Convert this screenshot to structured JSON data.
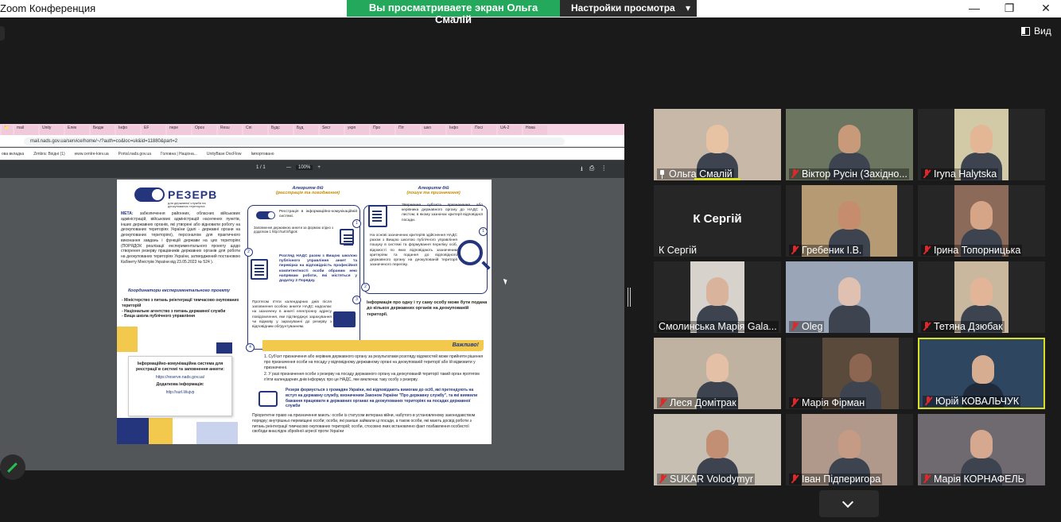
{
  "window": {
    "app_title": "Zoom Конференция",
    "viewing_banner": "Вы просматриваете экран Ольга Смалій",
    "view_options": "Настройки просмотра",
    "view_options_chevron": "▾",
    "minimize": "—",
    "maximize": "❐",
    "close": "✕",
    "view_button": "Вид"
  },
  "browser": {
    "tabs": [
      "📁",
      "mail",
      "Unity",
      "Елек",
      "Бюдж",
      "Інфо",
      "EF",
      "пере",
      "Opos",
      "Resu",
      "Спі",
      "Будс",
      "Буд",
      "Secr",
      "укрп",
      "Про",
      "Піт",
      "шко",
      "Інфо",
      "Посі",
      "UA-2",
      "Нова"
    ],
    "url": "mail.nads.gov.ua/service/home/~/?auth=co&loc=uk&id=11880&part=2",
    "bookmarks": [
      "ова вкладка",
      "Zimbra: Вхідні (1)",
      "www.centre-kiev.ua",
      "Portal.nads.gov.ua",
      "Головна | Націона...",
      "UnityBase DocFlow",
      "Імпортовано"
    ]
  },
  "pdf": {
    "page_indicator": "1 / 1",
    "zoom_minus": "—",
    "zoom_value": "100%",
    "zoom_plus": "+",
    "logo_name": "РЕЗЕРВ",
    "logo_sub": "для державної служби на деокупованих територіях",
    "meta_label": "МЕТА:",
    "meta_text": "забезпечення районних, обласних військових адміністрацій, військових адміністрацій населених пунктів, інших державних органів, які утворені або відновили роботу на деокупованих територіях України (далі - державні органи на деокупованих територіях), персоналом для практичного виконання завдань і функцій держави на цих територіях (ПОРЯДОК реалізації експериментального проекту щодо створення резерву працівників державних органів для роботи на деокупованих територіях України, затверджений постановою Кабінету Міністрів України від 23.05.2023 № 524 ).",
    "coord_heading": "Координатори експериментального проекту",
    "coord_lines": [
      "- Міністерство з питань реінтеграції тимчасово окупованих територій",
      "- Національне агентство з питань державної служби",
      "- Вища школа публічного управління"
    ],
    "info_title": "Інформаційно-комунікаційна система для реєстрації в системі та заповнення анкети:",
    "info_link": "https://reserve.nads.gov.ua/",
    "info_extra_title": "Додаткова інформація:",
    "info_extra_link": "http://surl.li/iujvp",
    "alg1_title": "Алгоритм дій",
    "alg1_sub": "(реєстрація та погодження)",
    "alg2_title": "Алгоритм дій",
    "alg2_sub": "(пошук та призначення)",
    "step1": "Реєстрація в інформаційно-комунікаційній системі.",
    "step1_note": "Заповнення державною анкети за формою згідно з додатком 1 http://surl.li/fqpok",
    "step2": "Розгляд НАДС разом з Вищою школою публічного управління анкет та перевірка на відповідність професійної компетентності особи обраним нею напрямам роботи, які містяться у додатку 2 Порядку.",
    "step4": "Протягом п'яти календарних днів після заповнення особою анкети НАДС надсилає на зазначену в анкеті електронну адресу повідомлення, яке підтверджує зарахування чи відмову у зарахуванні до резерву з відповідним обґрунтуванням.",
    "stepR1": "Звернення суб'єкта призначення або керівника державного органу до НАДС з листом, в якому зазначає критерії відповідної посади.",
    "stepR2": "На основі зазначених критеріїв здійснення НАДС разом з Вищою школою публічного управління пошуку в системі та формування переліку осіб, відомості по яких відповідають зазначеним критеріям та подання до відповідного державного органу на деокупованій території зазначеного переліку.",
    "info_note": "Інформація про одну і ту саму особу може бути подана до кількох державних органів на деокупованій території.",
    "important": "Важливо!",
    "important_1": "1. Суб'єкт призначення або керівник державного органу за результатами розгляду відомостей може прийняти рішення про призначення особи на посаду у відповідному державному органі на деокупованій території або їй відмовити у призначенні.",
    "important_2": "2. У разі призначення особи з резерву на посаду державного органу на деокупованій території такий орган протягом п'яти календарних днів інформує про це НАДС, яке виключає таку особу з резерву.",
    "reserve_text": "Резерв формується з громадян України, які відповідають вимогам до осіб, які претендують на вступ на державну службу, визначеним Законом України \"Про державну службу\", та які виявили бажання працювати в державних органах на деокупованих територіях на посадах державної служби",
    "priority_text": "Пріоритетне право на призначення мають: особи із статусом ветерана війни, набутого в установленому законодавством порядку; внутрішньо переміщені особи; особи, які раніше займали ці посади, а також особи, які мають досвід роботи з питань реінтеграції тимчасово окупованих територій; особи, стосовно яких встановлено факт позбавлення особистої свободи внаслідок збройної агресії проти України"
  },
  "participants": [
    {
      "name": "Ольга Смалій",
      "muted": false,
      "pinned": true,
      "active": false
    },
    {
      "name": "Віктор Русін (Західно...",
      "muted": true,
      "pinned": false,
      "active": false
    },
    {
      "name": "Iryna Halytska",
      "muted": true,
      "pinned": false,
      "active": false
    },
    {
      "name": "К Сергій",
      "muted": false,
      "pinned": false,
      "active": false,
      "avatar_text": "К Сергій"
    },
    {
      "name": "Гребеник І.В.",
      "muted": true,
      "pinned": false,
      "active": false
    },
    {
      "name": "Ірина Топорницька",
      "muted": true,
      "pinned": false,
      "active": false
    },
    {
      "name": "Смолинська Марія Gala...",
      "muted": false,
      "pinned": false,
      "active": false
    },
    {
      "name": "Oleg",
      "muted": true,
      "pinned": false,
      "active": false
    },
    {
      "name": "Тетяна Дзюбак",
      "muted": true,
      "pinned": false,
      "active": false
    },
    {
      "name": "Леся Домітрак",
      "muted": true,
      "pinned": false,
      "active": false
    },
    {
      "name": "Марія Фірман",
      "muted": true,
      "pinned": false,
      "active": false
    },
    {
      "name": "Юрій КОВАЛЬЧУК",
      "muted": true,
      "pinned": false,
      "active": true
    },
    {
      "name": "SUKAR Volodymyr",
      "muted": true,
      "pinned": false,
      "active": false
    },
    {
      "name": "Іван Підперигора",
      "muted": true,
      "pinned": false,
      "active": false
    },
    {
      "name": "Марія КОРНАФЕЛЬ",
      "muted": true,
      "pinned": false,
      "active": false
    }
  ],
  "colors": {
    "share_banner": "#23a85c",
    "active_speaker_border": "#d9e021",
    "muted_mic": "#e02828",
    "doc_blue": "#24357d",
    "doc_yellow": "#f2c94c"
  }
}
